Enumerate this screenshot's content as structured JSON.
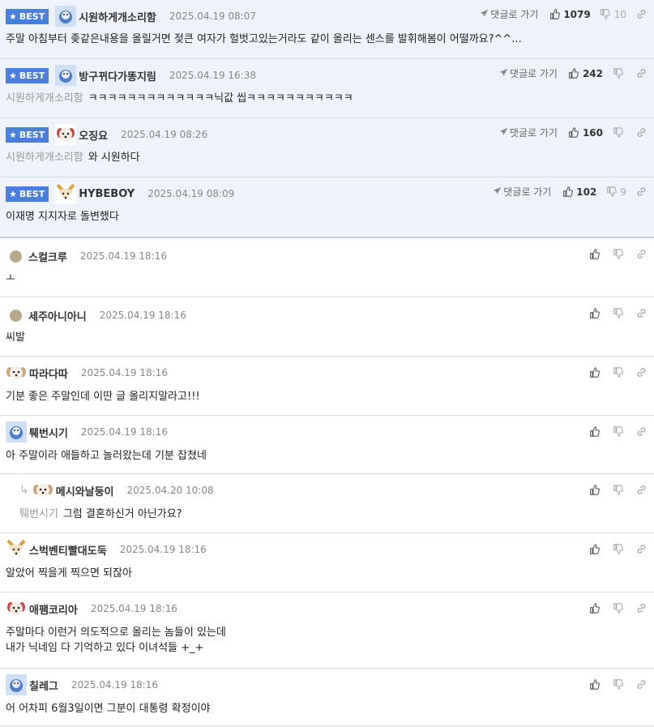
{
  "labels": {
    "best": "BEST",
    "goto_reply": "댓글로 가기"
  },
  "best_comments": [
    {
      "nick": "시원하게개소리함",
      "date": "2025.04.19 08:07",
      "mention": "",
      "text": "주말 아침부터 좆같은내용을 올릴거면 젖큰 여자가 헐벗고있는거라도 같이 올리는 센스를 발휘해봄이 어떨까요?^^...",
      "up": "1079",
      "down": "10",
      "avatar": "blue"
    },
    {
      "nick": "방구뀌다가똥지림",
      "date": "2025.04.19 16:38",
      "mention": "시원하게개소리함",
      "text": "ㅋㅋㅋㅋㅋㅋㅋㅋㅋㅋㅋㅋㅋ닉값 씹ㅋㅋㅋㅋㅋㅋㅋㅋㅋㅋㅋ",
      "up": "242",
      "down": "",
      "avatar": "blue"
    },
    {
      "nick": "오징요",
      "date": "2025.04.19 08:26",
      "mention": "시원하게개소리함",
      "text": "와 시원하다",
      "up": "160",
      "down": "",
      "avatar": "dog-red"
    },
    {
      "nick": "HYBEBOY",
      "date": "2025.04.19 08:09",
      "mention": "",
      "text": "이재명 지지자로 돌변했다",
      "up": "102",
      "down": "9",
      "avatar": "fox"
    }
  ],
  "comments": [
    {
      "nick": "스컬크루",
      "date": "2025.04.19 18:16",
      "mention": "",
      "lines": [
        "ㅗ"
      ],
      "avatar": "dot",
      "reply": false
    },
    {
      "nick": "세주아니아니",
      "date": "2025.04.19 18:16",
      "mention": "",
      "lines": [
        "씨발"
      ],
      "avatar": "dot",
      "reply": false
    },
    {
      "nick": "따라다따",
      "date": "2025.04.19 18:16",
      "mention": "",
      "lines": [
        "기분 좋은 주말인데 이딴 글 올리지말라고!!!"
      ],
      "avatar": "puppy",
      "reply": false
    },
    {
      "nick": "퉤번시기",
      "date": "2025.04.19 18:16",
      "mention": "",
      "lines": [
        "아 주말이라 애들하고 놀러왔는데 기분 잡쳤네"
      ],
      "avatar": "blue",
      "reply": false
    },
    {
      "nick": "메시와날둥이",
      "date": "2025.04.20 10:08",
      "mention": "퉤번시기",
      "lines": [
        "그럼 결혼하신거 아닌가요?"
      ],
      "avatar": "puppy",
      "reply": true
    },
    {
      "nick": "스벅벤티빨대도둑",
      "date": "2025.04.19 18:16",
      "mention": "",
      "lines": [
        "알았어 찍을게 찍으면 되잖아"
      ],
      "avatar": "fox",
      "reply": false
    },
    {
      "nick": "애팸코리아",
      "date": "2025.04.19 18:16",
      "mention": "",
      "lines": [
        "주말마다 이런거 의도적으로 올리는 놈들이 있는데",
        "내가 닉네임 다 기억하고 있다 이녀석들 +_+"
      ],
      "avatar": "dog-red",
      "reply": false
    },
    {
      "nick": "칠레그",
      "date": "2025.04.19 18:16",
      "mention": "",
      "lines": [
        "어 어차피 6월3일이면 그분이 대통령 확정이야"
      ],
      "avatar": "blue",
      "reply": false
    }
  ],
  "colors": {
    "best_bg": "#eef2fb",
    "badge": "#4a7fe0",
    "mention": "#999999"
  },
  "icons": [
    "star-icon",
    "paper-plane-icon",
    "thumbs-up-icon",
    "thumbs-down-icon",
    "link-icon",
    "reply-arrow-icon"
  ]
}
